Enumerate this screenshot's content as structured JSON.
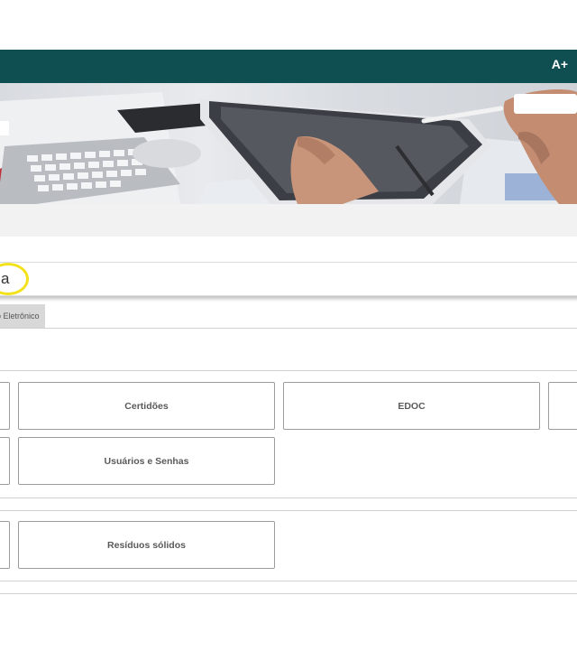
{
  "header": {
    "font_increase_label": "A+"
  },
  "search": {
    "visible_text": "a"
  },
  "tab": {
    "label": "o Eletrônico"
  },
  "sections": [
    {
      "tiles": [
        "Certidões",
        "EDOC",
        "Usuários e Senhas"
      ]
    },
    {
      "tiles": [
        "Resíduos sólidos"
      ]
    }
  ],
  "colors": {
    "header_bg": "#0f4f52",
    "highlight": "#f3e21b"
  }
}
